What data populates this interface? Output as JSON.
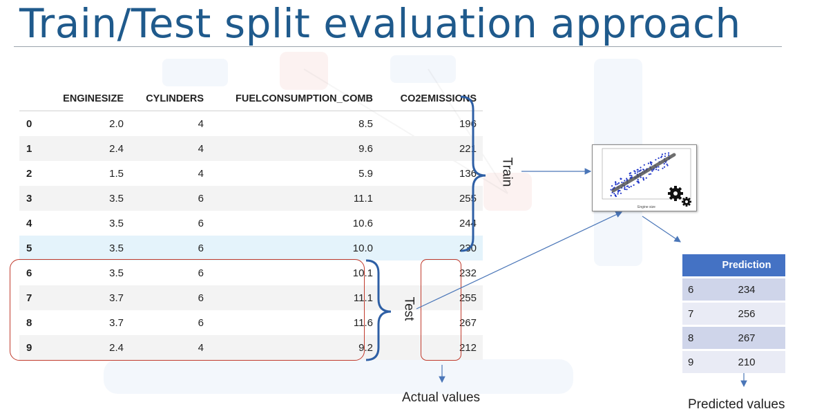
{
  "slide": {
    "title": "Train/Test split evaluation approach"
  },
  "dataframe": {
    "columns": [
      "",
      "ENGINESIZE",
      "CYLINDERS",
      "FUELCONSUMPTION_COMB",
      "CO2EMISSIONS"
    ],
    "rows": [
      [
        "0",
        "2.0",
        "4",
        "8.5",
        "196"
      ],
      [
        "1",
        "2.4",
        "4",
        "9.6",
        "221"
      ],
      [
        "2",
        "1.5",
        "4",
        "5.9",
        "136"
      ],
      [
        "3",
        "3.5",
        "6",
        "11.1",
        "255"
      ],
      [
        "4",
        "3.5",
        "6",
        "10.6",
        "244"
      ],
      [
        "5",
        "3.5",
        "6",
        "10.0",
        "230"
      ],
      [
        "6",
        "3.5",
        "6",
        "10.1",
        "232"
      ],
      [
        "7",
        "3.7",
        "6",
        "11.1",
        "255"
      ],
      [
        "8",
        "3.7",
        "6",
        "11.6",
        "267"
      ],
      [
        "9",
        "2.4",
        "4",
        "9.2",
        "212"
      ]
    ]
  },
  "labels": {
    "train": "Train",
    "test": "Test",
    "actual_values": "Actual values",
    "predicted_values": "Predicted values"
  },
  "model_plot": {
    "xlabel": "Engine size",
    "gear_icon": "gear-icon"
  },
  "prediction_table": {
    "header": "Prediction",
    "rows": [
      [
        "6",
        "234"
      ],
      [
        "7",
        "256"
      ],
      [
        "8",
        "267"
      ],
      [
        "9",
        "210"
      ]
    ]
  },
  "colors": {
    "title": "#1f5a8c",
    "brace": "#2e5fa5",
    "red_box": "#c0392b",
    "arrow": "#4a76b8",
    "pred_header": "#4472c4"
  }
}
